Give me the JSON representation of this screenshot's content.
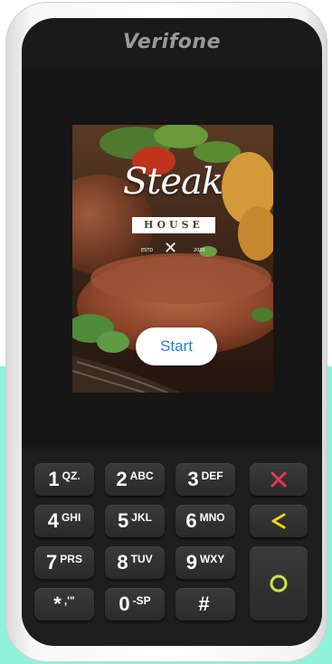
{
  "device": {
    "brand": "Verifone"
  },
  "screen": {
    "logo": {
      "title": "Steak",
      "subtitle": "HOUSE",
      "estd": "ESTD",
      "year": "2020"
    },
    "start_label": "Start"
  },
  "keypad": {
    "keys": [
      {
        "num": "1",
        "sub": "QZ."
      },
      {
        "num": "2",
        "sub": "ABC"
      },
      {
        "num": "3",
        "sub": "DEF"
      },
      {
        "num": "4",
        "sub": "GHI"
      },
      {
        "num": "5",
        "sub": "JKL"
      },
      {
        "num": "6",
        "sub": "MNO"
      },
      {
        "num": "7",
        "sub": "PRS"
      },
      {
        "num": "8",
        "sub": "TUV"
      },
      {
        "num": "9",
        "sub": "WXY"
      },
      {
        "num": "*",
        "sub": ",'\""
      },
      {
        "num": "0",
        "sub": "-SP"
      },
      {
        "num": "#",
        "sub": ""
      }
    ],
    "cancel_icon": "x-icon",
    "clear_icon": "back-arrow-icon",
    "enter_icon": "circle-icon",
    "colors": {
      "cancel": "#e8365a",
      "clear": "#f2d21b",
      "enter": "#c8e24a"
    }
  },
  "colors": {
    "accent_bg": "#8ff2da",
    "start_text": "#2a7fd4"
  }
}
